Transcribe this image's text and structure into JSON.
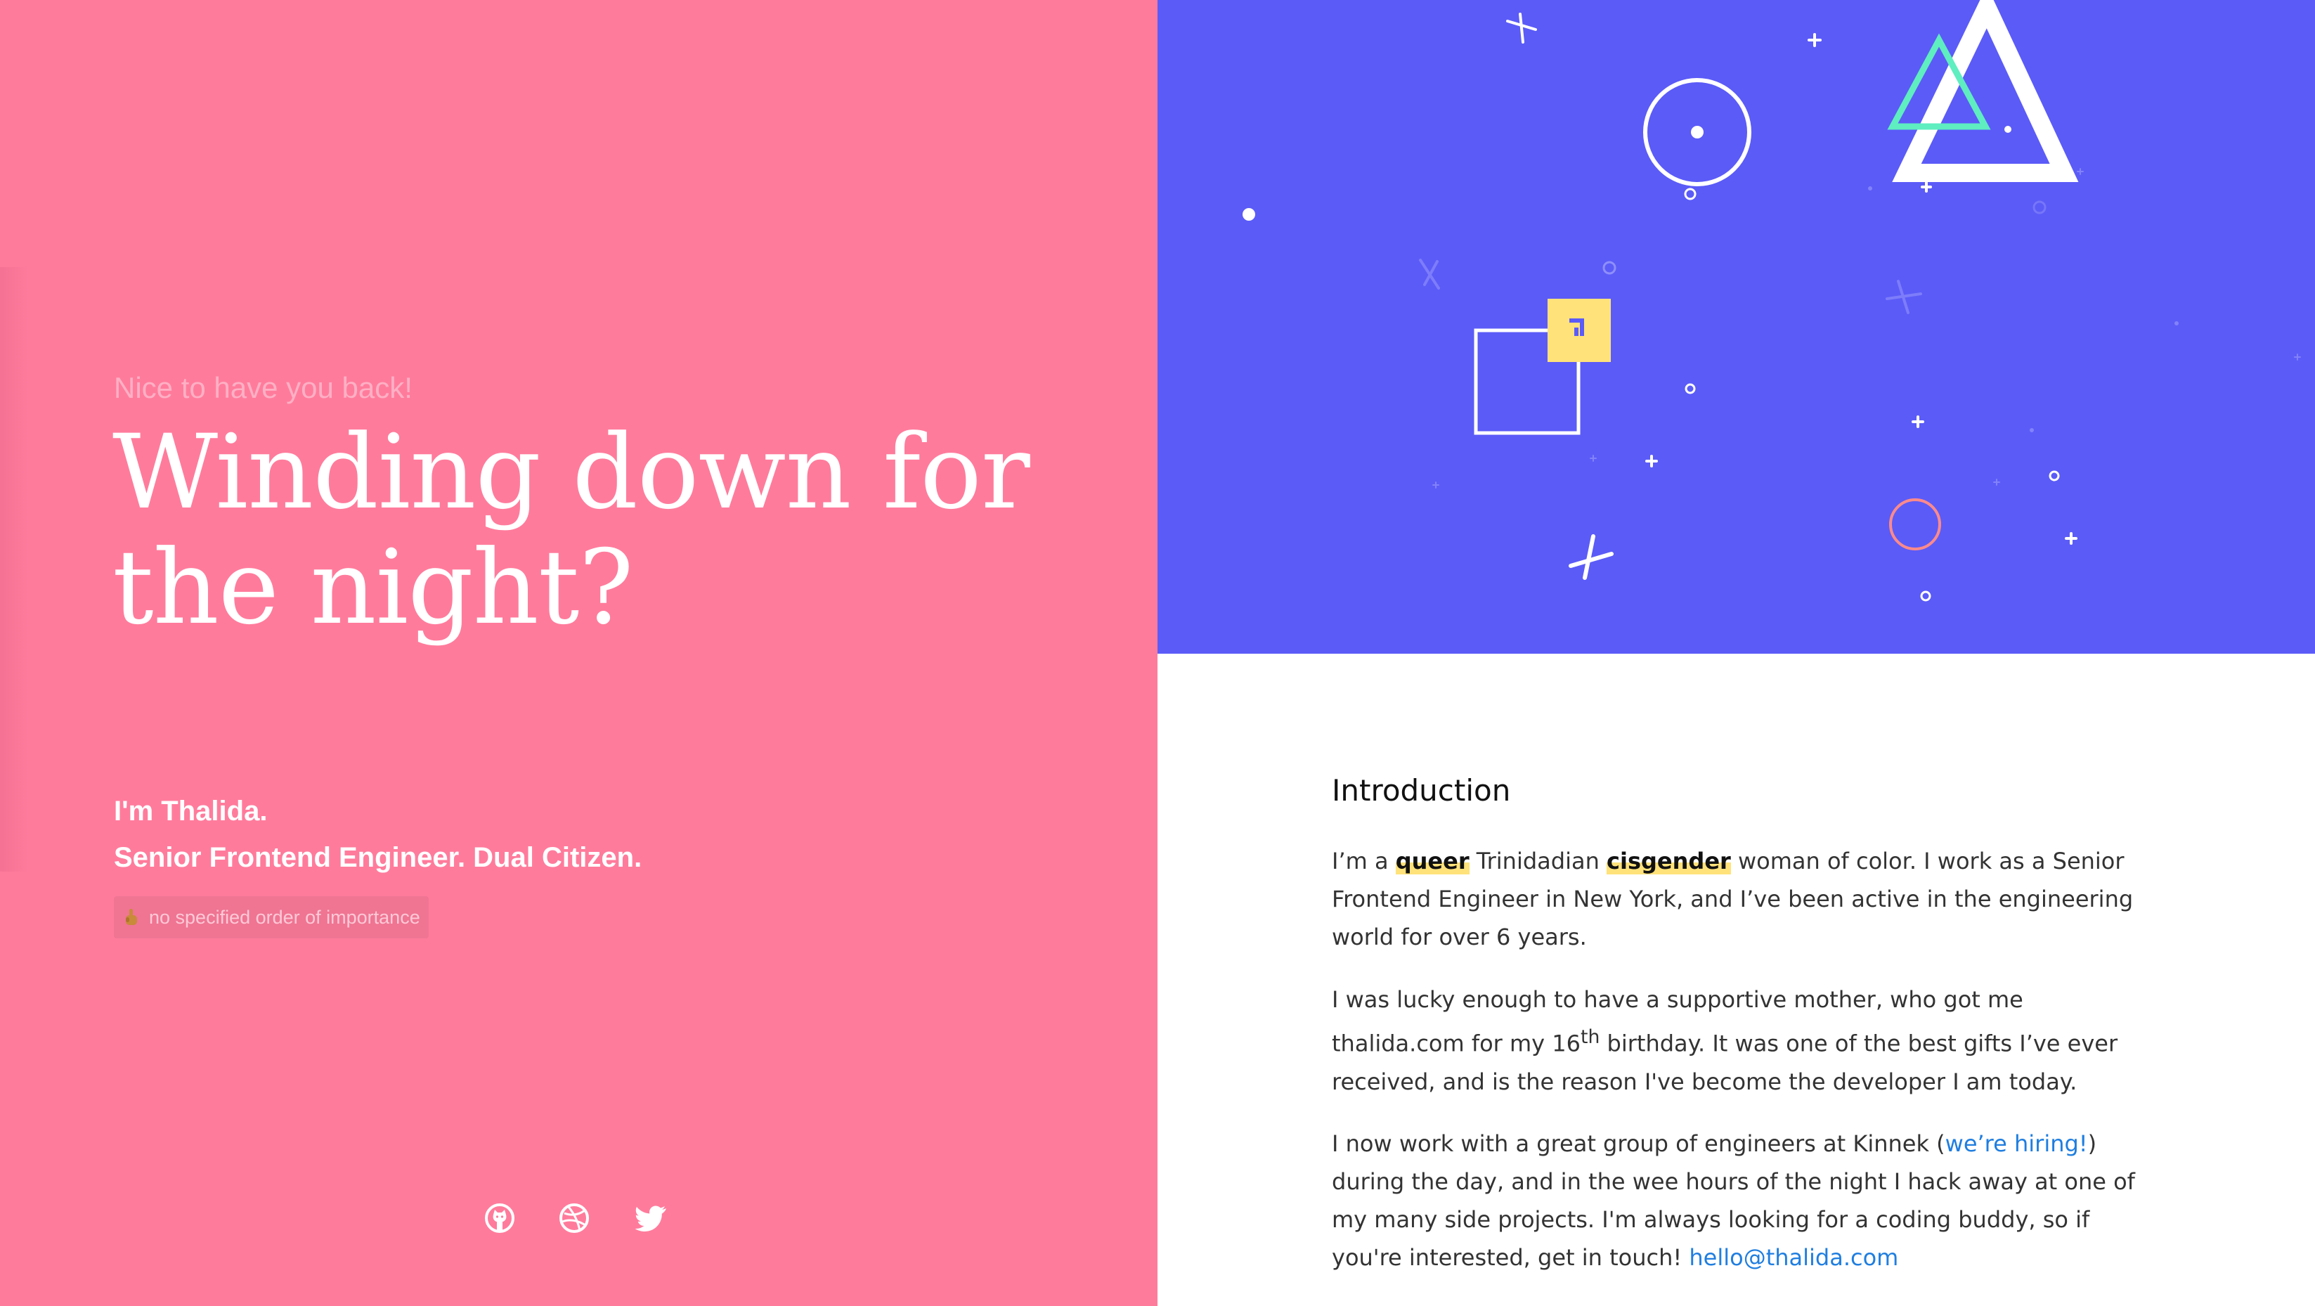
{
  "hero": {
    "greeting": "Nice to have you back!",
    "headline_line1": "Winding down for",
    "headline_line2": "the night?",
    "intro_name": "I'm Thalida.",
    "intro_role": "Senior Frontend Engineer. Dual Citizen.",
    "note_text": "no specified order of importance",
    "note_icon": "pointing-up-hand-icon",
    "social": [
      {
        "name": "github",
        "icon": "github-icon"
      },
      {
        "name": "dribbble",
        "icon": "dribbble-icon"
      },
      {
        "name": "twitter",
        "icon": "twitter-icon"
      }
    ]
  },
  "about": {
    "title": "Introduction",
    "p1": {
      "t1": "I’m a ",
      "h1": "queer",
      "t2": " Trinidadian ",
      "h2": "cisgender",
      "t3": " woman of color. I work as a Senior Frontend Engineer in New York, and I’ve been active in the engineering world for over 6 years."
    },
    "p2": {
      "t1": "I was lucky enough to have a supportive mother, who got me thalida.com for my 16",
      "sup": "th",
      "t2": " birthday. It was one of the best gifts I’ve ever received, and is the reason I've become the developer I am today."
    },
    "p3": {
      "t1": "I now work with a great group of engineers at Kinnek (",
      "link1": "we’re hiring!",
      "t2": ") during the day, and in the wee hours of the night I hack away at one of my many side projects. I'm always looking for a coding buddy, so if you're interested, get in touch! ",
      "link2": "hello@thalida.com"
    }
  },
  "colors": {
    "left_bg": "#ff7b9c",
    "right_top_bg": "#5b5bf8",
    "highlight": "#ffe27a",
    "link": "#1f7ee0",
    "accent_green": "#5eeec0",
    "accent_yellow": "#ffe27a",
    "accent_coral": "#ff8a8a"
  }
}
